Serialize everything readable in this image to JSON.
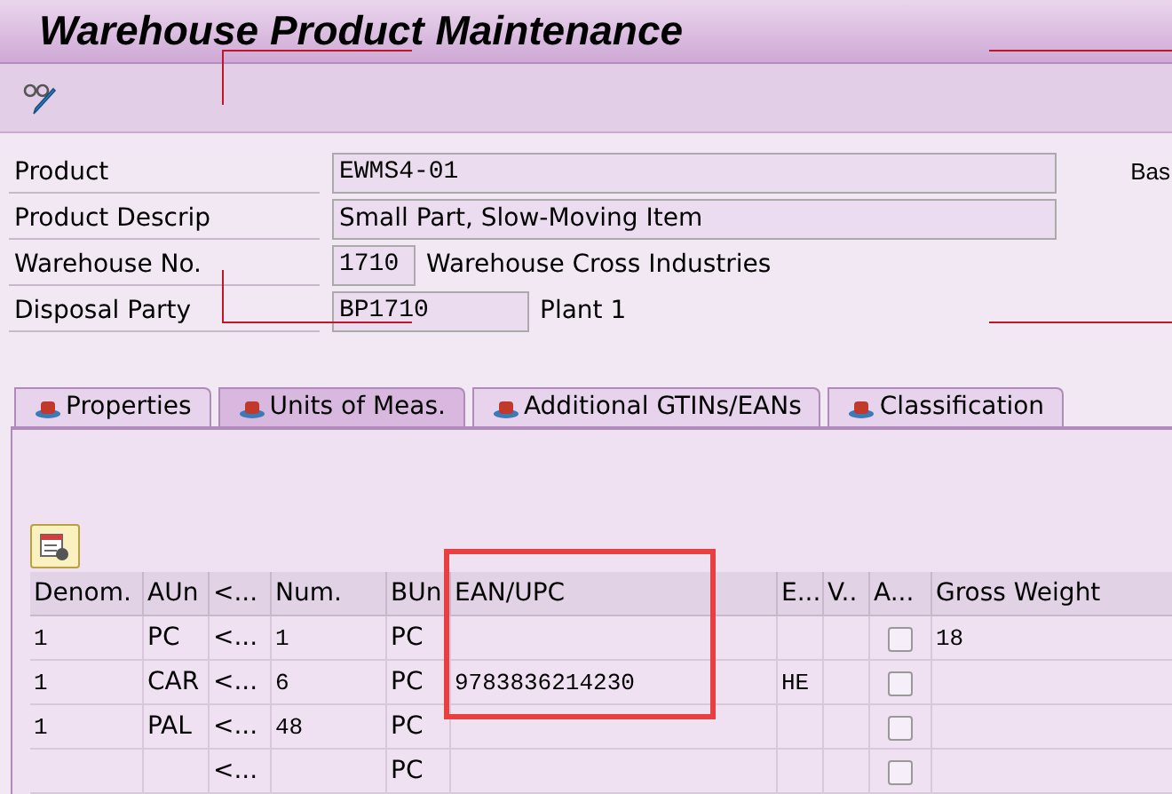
{
  "window": {
    "title": "Warehouse Product Maintenance"
  },
  "fields": [
    {
      "label": "Product",
      "value": "EWMS4-01",
      "kind": "wide"
    },
    {
      "label": "Product Descrip",
      "value": "Small Part, Slow-Moving Item",
      "kind": "wide-text"
    },
    {
      "label": "Warehouse No.",
      "value": "1710",
      "description": "Warehouse Cross Industries",
      "kind": "short"
    },
    {
      "label": "Disposal Party",
      "value": "BP1710",
      "description": "Plant 1",
      "kind": "medium"
    }
  ],
  "side_label": "Bas",
  "tabs": [
    {
      "label": "Properties",
      "selected": false
    },
    {
      "label": "Units of Meas.",
      "selected": true
    },
    {
      "label": "Additional GTINs/EANs",
      "selected": false
    },
    {
      "label": "Classification",
      "selected": false
    }
  ],
  "table": {
    "columns": [
      "Denom.",
      "AUn",
      "<...",
      "Num.",
      "BUn",
      "EAN/UPC",
      "E...",
      "V..",
      "A...",
      "Gross Weight"
    ],
    "rows": [
      {
        "cells": [
          "1",
          "PC",
          "<...",
          "1",
          "PC",
          "",
          "",
          "",
          "",
          "18"
        ],
        "checked": false
      },
      {
        "cells": [
          "1",
          "CAR",
          "<...",
          "6",
          "PC",
          "9783836214230",
          "HE",
          "",
          "",
          ""
        ],
        "checked": false
      },
      {
        "cells": [
          "1",
          "PAL",
          "<...",
          "48",
          "PC",
          "",
          "",
          "",
          "",
          ""
        ],
        "checked": false
      },
      {
        "cells": [
          "",
          "",
          "<...",
          "",
          "PC",
          "",
          "",
          "",
          "",
          ""
        ],
        "checked": false
      }
    ]
  }
}
